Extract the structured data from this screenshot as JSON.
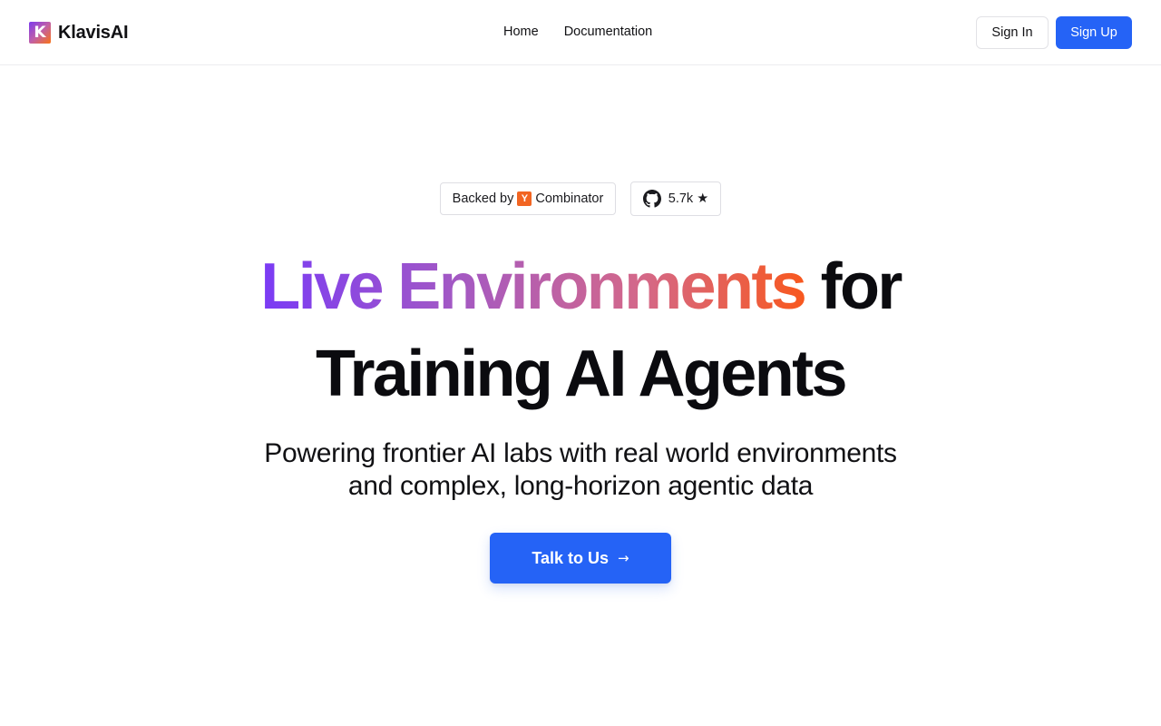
{
  "header": {
    "brand": {
      "logo_letter": "K",
      "name": "KlavisAI"
    },
    "nav": [
      {
        "label": "Home"
      },
      {
        "label": "Documentation"
      }
    ],
    "sign_in_label": "Sign In",
    "sign_up_label": "Sign Up"
  },
  "badges": {
    "yc_prefix": "Backed by",
    "yc_logo_letter": "Y",
    "yc_suffix": "Combinator",
    "github_stars": "5.7k",
    "star_glyph": "★",
    "github_icon": "github-icon"
  },
  "hero": {
    "headline_gradient": "Live Environments",
    "headline_rest": "for",
    "headline_line2": "Training AI Agents",
    "subtitle_line1": "Powering frontier AI labs with real world environments",
    "subtitle_line2": "and complex, long-horizon agentic data",
    "cta_label": "Talk to Us",
    "cta_arrow": "→"
  },
  "colors": {
    "primary_blue": "#2563f6",
    "gradient_start": "#7a3bf5",
    "gradient_end": "#f8581e",
    "yc_orange": "#f26522"
  }
}
